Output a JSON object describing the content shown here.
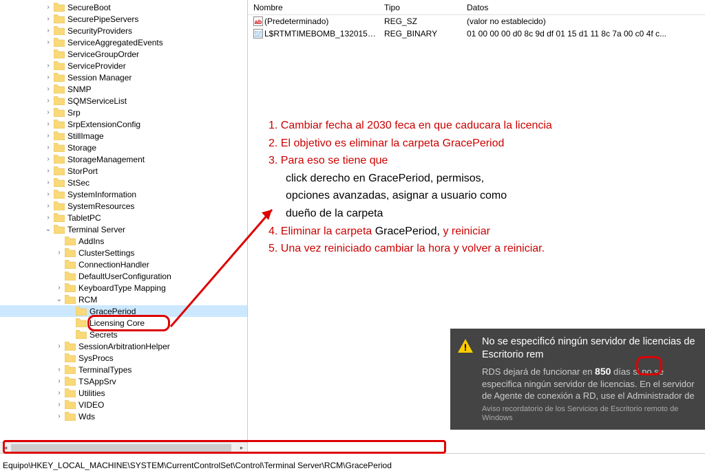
{
  "tree": {
    "items": [
      {
        "depth": 4,
        "exp": ">",
        "label": "SecureBoot"
      },
      {
        "depth": 4,
        "exp": ">",
        "label": "SecurePipeServers"
      },
      {
        "depth": 4,
        "exp": ">",
        "label": "SecurityProviders"
      },
      {
        "depth": 4,
        "exp": ">",
        "label": "ServiceAggregatedEvents"
      },
      {
        "depth": 4,
        "exp": "",
        "label": "ServiceGroupOrder"
      },
      {
        "depth": 4,
        "exp": ">",
        "label": "ServiceProvider"
      },
      {
        "depth": 4,
        "exp": ">",
        "label": "Session Manager"
      },
      {
        "depth": 4,
        "exp": ">",
        "label": "SNMP"
      },
      {
        "depth": 4,
        "exp": ">",
        "label": "SQMServiceList"
      },
      {
        "depth": 4,
        "exp": ">",
        "label": "Srp"
      },
      {
        "depth": 4,
        "exp": ">",
        "label": "SrpExtensionConfig"
      },
      {
        "depth": 4,
        "exp": ">",
        "label": "StillImage"
      },
      {
        "depth": 4,
        "exp": ">",
        "label": "Storage"
      },
      {
        "depth": 4,
        "exp": ">",
        "label": "StorageManagement"
      },
      {
        "depth": 4,
        "exp": ">",
        "label": "StorPort"
      },
      {
        "depth": 4,
        "exp": ">",
        "label": "StSec"
      },
      {
        "depth": 4,
        "exp": ">",
        "label": "SystemInformation"
      },
      {
        "depth": 4,
        "exp": ">",
        "label": "SystemResources"
      },
      {
        "depth": 4,
        "exp": ">",
        "label": "TabletPC"
      },
      {
        "depth": 4,
        "exp": "v",
        "label": "Terminal Server"
      },
      {
        "depth": 5,
        "exp": "",
        "label": "AddIns"
      },
      {
        "depth": 5,
        "exp": ">",
        "label": "ClusterSettings"
      },
      {
        "depth": 5,
        "exp": "",
        "label": "ConnectionHandler"
      },
      {
        "depth": 5,
        "exp": "",
        "label": "DefaultUserConfiguration"
      },
      {
        "depth": 5,
        "exp": ">",
        "label": "KeyboardType Mapping"
      },
      {
        "depth": 5,
        "exp": "v",
        "label": "RCM"
      },
      {
        "depth": 6,
        "exp": "",
        "label": "GracePeriod",
        "selected": true
      },
      {
        "depth": 6,
        "exp": "",
        "label": "Licensing Core"
      },
      {
        "depth": 6,
        "exp": "",
        "label": "Secrets"
      },
      {
        "depth": 5,
        "exp": ">",
        "label": "SessionArbitrationHelper"
      },
      {
        "depth": 5,
        "exp": "",
        "label": "SysProcs"
      },
      {
        "depth": 5,
        "exp": ">",
        "label": "TerminalTypes"
      },
      {
        "depth": 5,
        "exp": ">",
        "label": "TSAppSrv"
      },
      {
        "depth": 5,
        "exp": ">",
        "label": "Utilities"
      },
      {
        "depth": 5,
        "exp": ">",
        "label": "VIDEO"
      },
      {
        "depth": 5,
        "exp": ">",
        "label": "Wds"
      }
    ]
  },
  "listHeader": {
    "name": "Nombre",
    "type": "Tipo",
    "data": "Datos"
  },
  "listRows": [
    {
      "icon": "str",
      "name": "(Predeterminado)",
      "type": "REG_SZ",
      "data": "(valor no establecido)"
    },
    {
      "icon": "bin",
      "name": "L$RTMTIMEBOMB_1320153D...",
      "type": "REG_BINARY",
      "data": "01 00 00 00 d0 8c 9d df 01 15 d1 11 8c 7a 00 c0 4f c..."
    }
  ],
  "annotations": {
    "l1": "1. Cambiar fecha al 2030 feca en que caducara la licencia",
    "l2": "2. El objetivo es eliminar la carpeta GracePeriod",
    "l3": "3. Para eso se tiene que",
    "l3a": "click derecho en GracePeriod, permisos,",
    "l3b": "opciones avanzadas, asignar a usuario como",
    "l3c": "dueño de la carpeta",
    "l4a": "4. Eliminar la carpeta  ",
    "l4b": "GracePeriod, ",
    "l4c": "y reiniciar",
    "l5": "5. Una vez reiniciado cambiar la hora y volver a reiniciar."
  },
  "notification": {
    "title_a": "No se especificó ningún servidor de licencias de Escritorio rem",
    "body_a": "RDS dejará de funcionar en ",
    "body_days": "850",
    "body_b": " días si no se especifica ningún servidor de licencias. En el servidor de Agente de conexión a RD, use el Administrador de",
    "small": "Aviso recordatorio de los Servicios de Escritorio remoto de Windows"
  },
  "statusbar": "Equipo\\HKEY_LOCAL_MACHINE\\SYSTEM\\CurrentControlSet\\Control\\Terminal Server\\RCM\\GracePeriod"
}
